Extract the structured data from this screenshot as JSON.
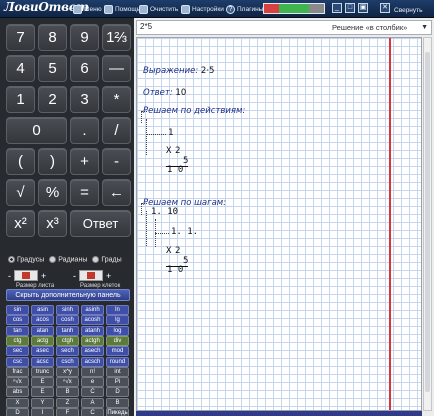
{
  "app": {
    "title": "ЛовиОтвет"
  },
  "toolbar": {
    "menu": "Меню",
    "help": "Помощь",
    "clear": "Очистить",
    "settings": "Настройки",
    "plugins": "Плагины",
    "collapse": "Свернуть",
    "colors": [
      "#d94040",
      "#3fb44f",
      "#3fb44f",
      "#8a8a8a"
    ]
  },
  "keypad": {
    "rows": [
      [
        "7",
        "8",
        "9",
        "1⅔"
      ],
      [
        "4",
        "5",
        "6",
        "—"
      ],
      [
        "1",
        "2",
        "3",
        "*"
      ],
      [
        "0",
        ".",
        "/"
      ],
      [
        "(",
        ")",
        "+",
        "-"
      ],
      [
        "√",
        "%",
        "=",
        "←"
      ],
      [
        "x²",
        "x³",
        "Ответ"
      ]
    ]
  },
  "angle_modes": {
    "degrees": "Градусы",
    "radians": "Радианы",
    "grads": "Грады",
    "selected": "degrees"
  },
  "sheet_size": {
    "label": "Размер листа",
    "minus": "-",
    "plus": "+"
  },
  "cell_size": {
    "label": "Размер клеток",
    "minus": "-",
    "plus": "+"
  },
  "extra_panel_toggle": "Скрыть дополнительную панель",
  "functions": [
    [
      "sin",
      "asin",
      "sinh",
      "asinh",
      "ln"
    ],
    [
      "cos",
      "acos",
      "cosh",
      "acosh",
      "lg"
    ],
    [
      "tan",
      "atan",
      "tanh",
      "atanh",
      "log"
    ],
    [
      "ctg",
      "actg",
      "ctgh",
      "actgh",
      "div"
    ],
    [
      "sec",
      "asec",
      "sech",
      "asech",
      "mod"
    ],
    [
      "csc",
      "acsc",
      "csch",
      "acsch",
      "round"
    ],
    [
      "frac",
      "trunc",
      "x^y",
      "n!",
      "int"
    ],
    [
      "ⁿ√x",
      "E",
      "ⁿ√x",
      "e",
      "Pi"
    ],
    [
      "abs",
      "E",
      "B",
      "C",
      "D"
    ],
    [
      "X",
      "Y",
      "Z",
      "A",
      "B"
    ],
    [
      "D",
      "I",
      "F",
      "C",
      "Пикедь"
    ]
  ],
  "function_colors": [
    "#3f4fa8",
    "#3f4fa8",
    "#3f4fa8",
    "#5d7a3c",
    "#3f4fa8",
    "#3f4fa8",
    "#4a4f58",
    "#4a4f58",
    "#4a4f58",
    "#4a4f58",
    "#4a4f58"
  ],
  "expression_input": "2*5",
  "method_select": {
    "value": "Решение «в столбик»"
  },
  "worksheet": {
    "expression_label": "Выражение:",
    "expression_value": "2·5",
    "answer_label": "Ответ:",
    "answer_value": "10",
    "by_actions_title": "Решаем по действиям:",
    "by_steps_title": "Решаем по шагам:",
    "action_carry": "1",
    "steps_result": "1. 10",
    "steps_carry": "1. 1.",
    "mult_times": "X",
    "mult_a": "2",
    "mult_b": "5",
    "mult_result": "1 0"
  }
}
